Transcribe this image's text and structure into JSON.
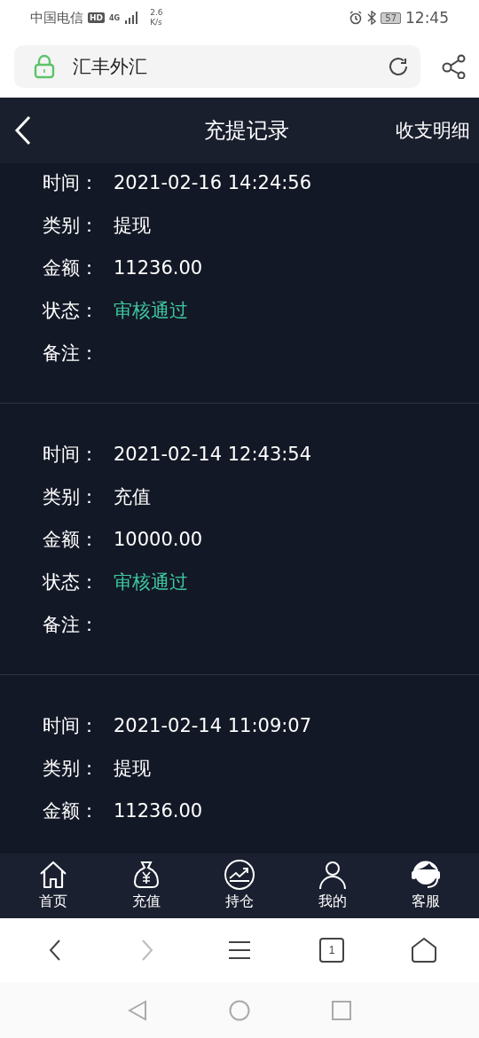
{
  "status_bar": {
    "carrier": "中国电信",
    "hd": "HD",
    "network": "4G",
    "speed": "2.6",
    "speed_unit": "K/s",
    "battery": "57",
    "time": "12:45"
  },
  "browser": {
    "title": "汇丰外汇"
  },
  "header": {
    "title": "充提记录",
    "action": "收支明细"
  },
  "records": [
    {
      "fields": [
        {
          "label": "时间：",
          "value": "2021-02-16 14:24:56",
          "kind": "plain"
        },
        {
          "label": "类别：",
          "value": "提现",
          "kind": "plain"
        },
        {
          "label": "金额：",
          "value": "11236.00",
          "kind": "plain"
        },
        {
          "label": "状态：",
          "value": "审核通过",
          "kind": "status"
        },
        {
          "label": "备注：",
          "kind": "plain"
        }
      ]
    },
    {
      "fields": [
        {
          "label": "时间：",
          "value": "2021-02-14 12:43:54",
          "kind": "plain"
        },
        {
          "label": "类别：",
          "value": "充值",
          "kind": "plain"
        },
        {
          "label": "金额：",
          "value": "10000.00",
          "kind": "plain"
        },
        {
          "label": "状态：",
          "value": "审核通过",
          "kind": "status"
        },
        {
          "label": "备注：",
          "kind": "plain"
        }
      ]
    },
    {
      "fields": [
        {
          "label": "时间：",
          "value": "2021-02-14 11:09:07",
          "kind": "plain"
        },
        {
          "label": "类别：",
          "value": "提现",
          "kind": "plain"
        },
        {
          "label": "金额：",
          "value": "11236.00",
          "kind": "plain"
        }
      ]
    }
  ],
  "bottom_nav": [
    {
      "label": "首页",
      "kind": "home"
    },
    {
      "label": "充值",
      "kind": "money"
    },
    {
      "label": "持仓",
      "kind": "chart"
    },
    {
      "label": "我的",
      "kind": "user"
    },
    {
      "label": "客服",
      "kind": "support"
    }
  ],
  "browser_toolbar": [
    {
      "kind": "back",
      "disabled": false
    },
    {
      "kind": "forward",
      "disabled": true
    },
    {
      "kind": "menu"
    },
    {
      "kind": "tabs",
      "count": "1"
    },
    {
      "kind": "home"
    }
  ]
}
